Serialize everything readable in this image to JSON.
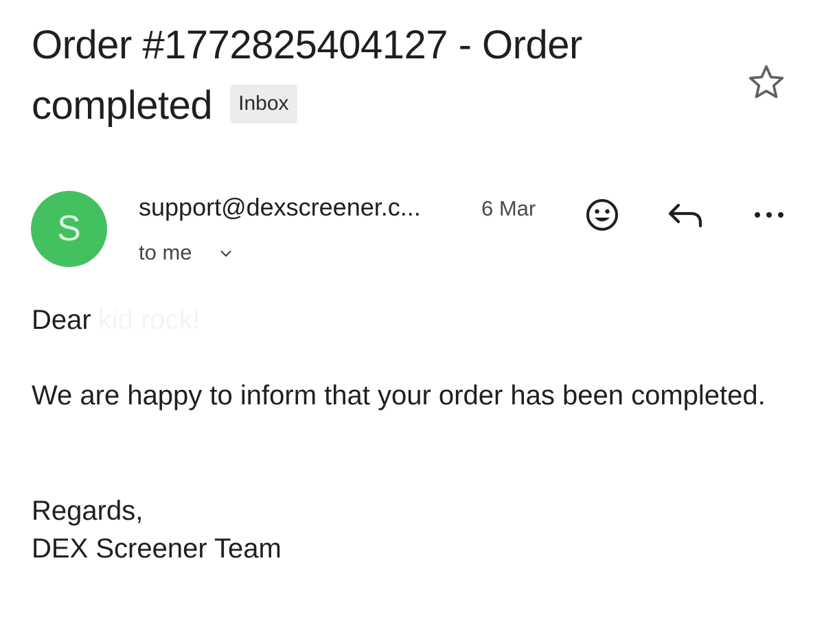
{
  "email": {
    "subject": "Order #1772825404127 - Order completed",
    "label": "Inbox",
    "sender": {
      "initial": "S",
      "address": "support@dexscreener.c...",
      "avatar_color": "#43c15e"
    },
    "date": "6 Mar",
    "recipient": "to me",
    "body": {
      "greeting": "Dear",
      "greeting_name": "kid rock!",
      "paragraph": "We are happy to inform that your order has been completed.",
      "closing": "Regards,",
      "signature": "DEX Screener Team"
    }
  },
  "icons": {
    "star": "star-outline-icon",
    "emoji": "smiley-face-icon",
    "reply": "reply-arrow-icon",
    "more": "more-dots-icon",
    "expand": "chevron-down-icon"
  }
}
